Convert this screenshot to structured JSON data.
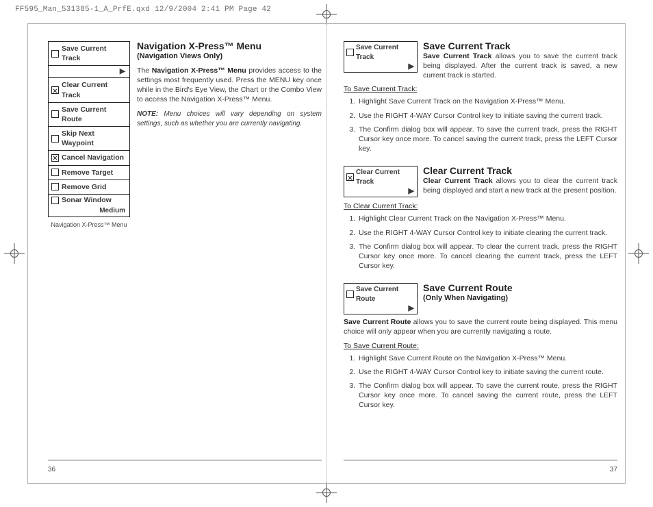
{
  "header": "FF595_Man_531385-1_A_PrfE.qxd  12/9/2004  2:41 PM  Page 42",
  "page_numbers": {
    "left": "36",
    "right": "37"
  },
  "menu": {
    "caption": "Navigation X-Press™ Menu",
    "items": [
      "Save Current Track",
      "Clear Current Track",
      "Save Current Route",
      "Skip Next Waypoint",
      "Cancel Navigation",
      "Remove Target",
      "Remove Grid"
    ],
    "sonar": {
      "label": "Sonar Window",
      "value": "Medium"
    },
    "arrow": "▶"
  },
  "left": {
    "title": "Navigation X-Press™ Menu",
    "subtitle": "(Navigation Views Only)",
    "para_pre": "The ",
    "para_bold": "Navigation X-Press™ Menu",
    "para_post": " provides access to the settings most frequently used.  Press the MENU key once while in the Bird's Eye View, the Chart or the Combo View to access the Navigation X-Press™ Menu.",
    "note_label": "NOTE:",
    "note_body": "  Menu choices will vary depending on system settings, such as whether you are currently navigating."
  },
  "right": {
    "s1": {
      "mini": "Save Current Track",
      "title": "Save Current Track",
      "lead_bold": "Save Current Track",
      "lead_rest": " allows you to save the current track being displayed. After the current track is saved, a new current track is started.",
      "howto": "To Save Current Track:",
      "steps": [
        "Highlight Save Current Track on the Navigation X-Press™ Menu.",
        "Use the RIGHT 4-WAY Cursor Control key to initiate saving the current track.",
        "The Confirm dialog box will appear. To save the current track,  press the RIGHT Cursor key once more. To cancel saving the current track, press the LEFT Cursor key."
      ]
    },
    "s2": {
      "mini": "Clear Current Track",
      "title": "Clear Current Track",
      "lead_bold": "Clear Current Track",
      "lead_rest": " allows you to clear the current track being displayed and start a new track at the present position.",
      "howto": "To Clear Current Track:",
      "steps": [
        "Highlight Clear Current Track on the Navigation X-Press™ Menu.",
        "Use the RIGHT 4-WAY Cursor Control key to initiate clearing the current track.",
        "The Confirm dialog box will appear. To clear the current track,  press the RIGHT Cursor key once more. To cancel clearing the current track, press the LEFT Cursor key."
      ]
    },
    "s3": {
      "mini": "Save Current Route",
      "title": "Save Current Route",
      "subtitle": "(Only When Navigating)",
      "lead_bold": "Save Current Route",
      "lead_rest": " allows you to save the current route being displayed. This menu choice will only appear when you are currently navigating a route.",
      "howto": "To Save Current Route:",
      "steps": [
        "Highlight Save Current Route on the Navigation X-Press™ Menu.",
        "Use the RIGHT 4-WAY Cursor Control key to initiate saving the current route.",
        "The Confirm dialog box will appear. To save the current route,  press the RIGHT Cursor key once more. To cancel saving the current route, press the LEFT Cursor key."
      ]
    }
  }
}
